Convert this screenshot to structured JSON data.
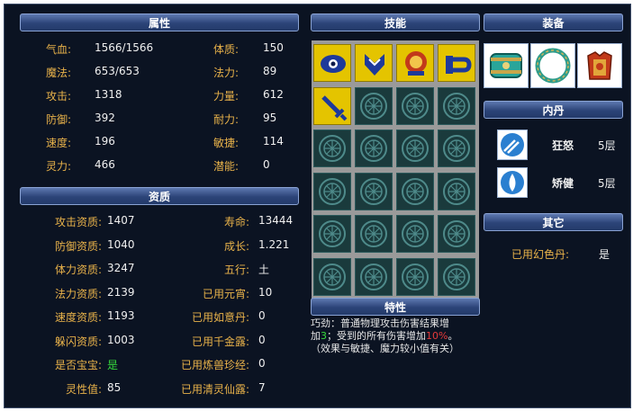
{
  "headers": {
    "attributes": "属性",
    "skills": "技能",
    "equipment": "装备",
    "inner_dan": "内丹",
    "aptitude": "资质",
    "other": "其它",
    "traits": "特性"
  },
  "attributes": [
    {
      "label": "气血:",
      "value": "1566/1566"
    },
    {
      "label": "魔法:",
      "value": "653/653"
    },
    {
      "label": "攻击:",
      "value": "1318"
    },
    {
      "label": "防御:",
      "value": "392"
    },
    {
      "label": "速度:",
      "value": "196"
    },
    {
      "label": "灵力:",
      "value": "466"
    }
  ],
  "attributes_right": [
    {
      "label": "体质:",
      "value": "150"
    },
    {
      "label": "法力:",
      "value": "89"
    },
    {
      "label": "力量:",
      "value": "612"
    },
    {
      "label": "耐力:",
      "value": "95"
    },
    {
      "label": "敏捷:",
      "value": "114"
    },
    {
      "label": "潜能:",
      "value": "0"
    }
  ],
  "aptitude_left": [
    {
      "label": "攻击资质:",
      "value": "1407"
    },
    {
      "label": "防御资质:",
      "value": "1040"
    },
    {
      "label": "体力资质:",
      "value": "3247"
    },
    {
      "label": "法力资质:",
      "value": "2139"
    },
    {
      "label": "速度资质:",
      "value": "1193"
    },
    {
      "label": "躲闪资质:",
      "value": "1003"
    },
    {
      "label": "是否宝宝:",
      "value": "是"
    },
    {
      "label": "灵性值:",
      "value": "85"
    }
  ],
  "aptitude_right": [
    {
      "label": "寿命:",
      "value": "13444"
    },
    {
      "label": "成长:",
      "value": "1.221"
    },
    {
      "label": "五行:",
      "value": "土"
    },
    {
      "label": "已用元宵:",
      "value": "10"
    },
    {
      "label": "已用如意丹:",
      "value": "0"
    },
    {
      "label": "已用千金露:",
      "value": "0"
    },
    {
      "label": "已用炼兽珍经:",
      "value": "0"
    },
    {
      "label": "已用清灵仙露:",
      "value": "7"
    }
  ],
  "skills": [
    "eye-skill-icon",
    "shield-skill-icon",
    "crest-skill-icon",
    "horn-skill-icon",
    "sword-skill-icon"
  ],
  "equipment": [
    "armguard-icon",
    "necklace-icon",
    "armor-icon"
  ],
  "inner_dan": [
    {
      "name": "狂怒",
      "level": "5层"
    },
    {
      "name": "矫健",
      "level": "5层"
    }
  ],
  "other": {
    "label": "已用幻色丹:",
    "value": "是"
  },
  "traits": {
    "line1": "巧劲：普通物理攻击伤害结果增",
    "line2a": "加",
    "line2b": "3",
    "line2c": "；受到的所有伤害增加",
    "line2d": "10%",
    "line2e": "。",
    "line3": "（效果与敏捷、魔力较小值有关）"
  }
}
